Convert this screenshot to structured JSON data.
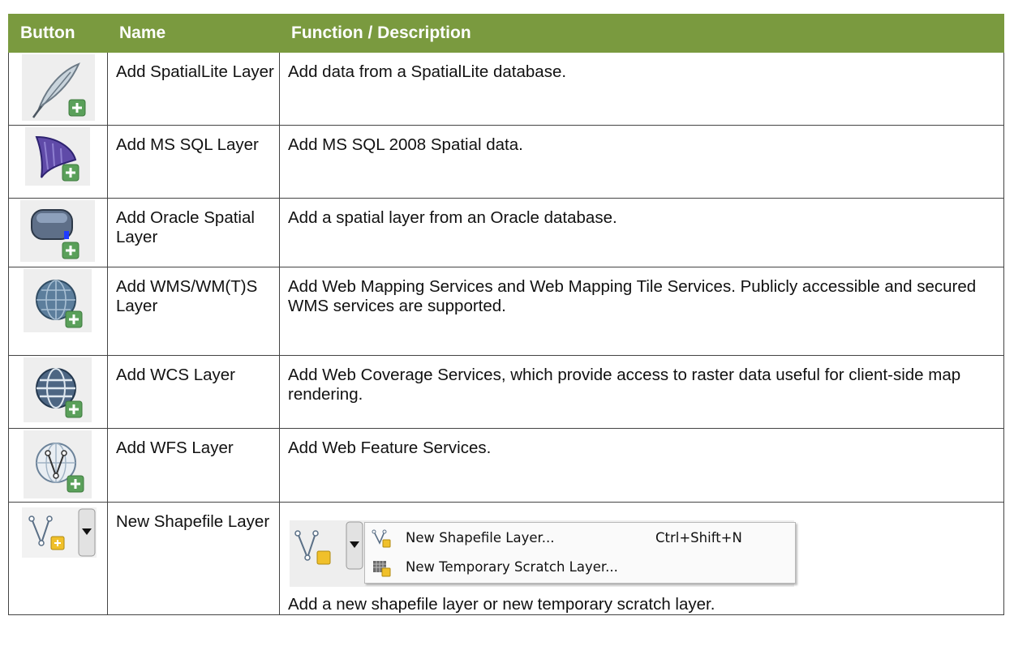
{
  "table": {
    "headers": [
      "Button",
      "Name",
      "Function / Description"
    ],
    "rows": [
      {
        "icon": "spatialite-feather-add-icon",
        "name": "Add SpatialLite Layer",
        "description": "Add data from a SpatialLite database."
      },
      {
        "icon": "mssql-add-icon",
        "name": "Add MS SQL Layer",
        "description": "Add MS SQL 2008 Spatial data."
      },
      {
        "icon": "oracle-add-icon",
        "name": "Add Oracle Spatial Layer",
        "description": "Add a spatial layer from an Oracle database."
      },
      {
        "icon": "wms-globe-add-icon",
        "name": "Add WMS/WM(T)S Layer",
        "description": "Add Web Mapping Services and Web Mapping Tile Services. Publicly accessible and secured WMS services are supported."
      },
      {
        "icon": "wcs-globe-add-icon",
        "name": "Add WCS Layer",
        "description": "Add Web Coverage Services, which provide access to raster data useful for client-side map rendering."
      },
      {
        "icon": "wfs-globe-add-icon",
        "name": "Add WFS Layer",
        "description": "Add Web Feature Services."
      },
      {
        "icon": "new-shapefile-dropdown-icon",
        "name": "New Shapefile Layer",
        "menu": [
          {
            "icon": "new-shapefile-icon",
            "label": "New Shapefile Layer...",
            "shortcut": "Ctrl+Shift+N"
          },
          {
            "icon": "new-scratch-layer-icon",
            "label": "New Temporary Scratch Layer...",
            "shortcut": ""
          }
        ],
        "description": "Add a new shapefile layer or new temporary scratch layer."
      }
    ]
  },
  "colors": {
    "header_bg": "#7a9a3f",
    "header_text": "#ffffff",
    "add_badge": "#5aa05a"
  }
}
